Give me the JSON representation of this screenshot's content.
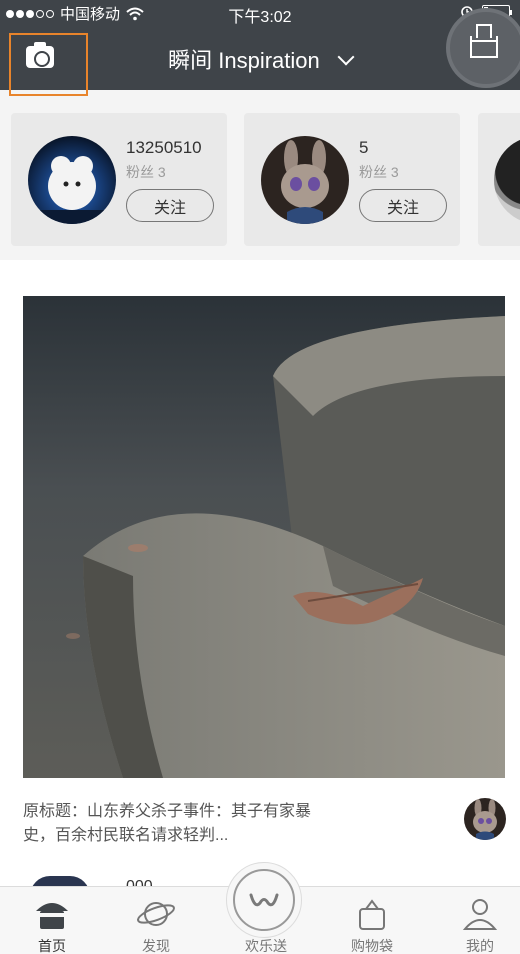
{
  "status_bar": {
    "carrier": "中国移动",
    "time": "下午3:02"
  },
  "nav": {
    "title": "瞬间 Inspiration",
    "camera_icon": "camera-icon",
    "inbox_icon": "inbox-icon"
  },
  "recommendations": [
    {
      "name": "13250510",
      "fans": "粉丝 3",
      "follow_label": "关注"
    },
    {
      "name": "5",
      "fans": "粉丝 3",
      "follow_label": "关注"
    }
  ],
  "post": {
    "caption": "原标题：山东养父杀子事件：其子有家暴史，百余村民联名请求轻判...",
    "next_author": "000"
  },
  "tabbar": {
    "tabs": [
      {
        "label": "首页",
        "icon": "home-icon"
      },
      {
        "label": "发现",
        "icon": "planet-icon"
      },
      {
        "label": "欢乐送",
        "icon": "w-logo-icon"
      },
      {
        "label": "购物袋",
        "icon": "bag-icon"
      },
      {
        "label": "我的",
        "icon": "person-icon"
      }
    ]
  },
  "colors": {
    "header_bg": "#3f4449",
    "highlight_border": "#e8842b",
    "page_bg": "#f4f4f4"
  }
}
